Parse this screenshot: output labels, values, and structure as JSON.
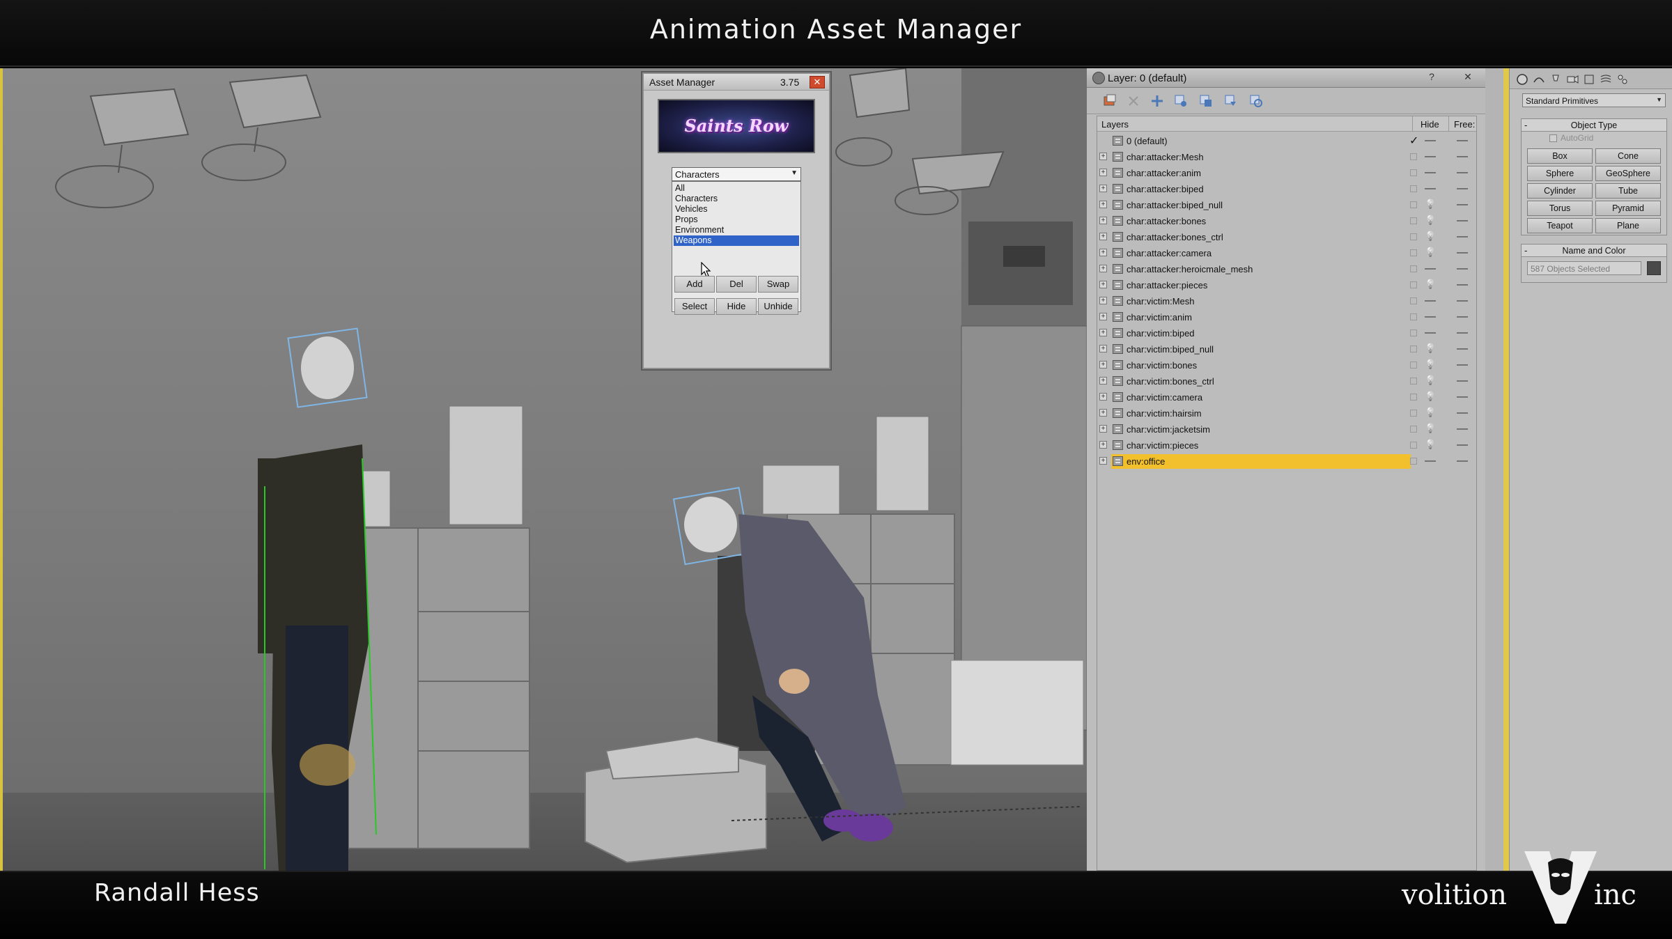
{
  "video": {
    "title": "Animation Asset Manager",
    "presenter": "Randall Hess",
    "brand_left": "volition",
    "brand_right": "inc"
  },
  "asset_manager": {
    "title": "Asset Manager",
    "version": "3.75",
    "logo_text": "Saints Row",
    "category_selected": "Characters",
    "category_options": [
      "All",
      "Characters",
      "Vehicles",
      "Props",
      "Environment",
      "Weapons"
    ],
    "highlighted_option": "Weapons",
    "buttons_row1": [
      "Add",
      "Del",
      "Swap"
    ],
    "buttons_row2": [
      "Select",
      "Hide",
      "Unhide"
    ]
  },
  "layer_manager": {
    "title": "Layer: 0 (default)",
    "columns": {
      "layers": "Layers",
      "hide": "Hide",
      "freeze": "Free:"
    },
    "rows": [
      {
        "name": "0 (default)",
        "current": true,
        "hide": "—",
        "freeze": "—"
      },
      {
        "name": "char:attacker:Mesh",
        "hide": "—",
        "freeze": "—"
      },
      {
        "name": "char:attacker:anim",
        "hide": "—",
        "freeze": "—"
      },
      {
        "name": "char:attacker:biped",
        "hide": "—",
        "freeze": "—"
      },
      {
        "name": "char:attacker:biped_null",
        "hide": "bulb",
        "freeze": "—"
      },
      {
        "name": "char:attacker:bones",
        "hide": "bulb",
        "freeze": "—"
      },
      {
        "name": "char:attacker:bones_ctrl",
        "hide": "bulb",
        "freeze": "—"
      },
      {
        "name": "char:attacker:camera",
        "hide": "bulb",
        "freeze": "—"
      },
      {
        "name": "char:attacker:heroicmale_mesh",
        "hide": "—",
        "freeze": "—"
      },
      {
        "name": "char:attacker:pieces",
        "hide": "bulb",
        "freeze": "—"
      },
      {
        "name": "char:victim:Mesh",
        "hide": "—",
        "freeze": "—"
      },
      {
        "name": "char:victim:anim",
        "hide": "—",
        "freeze": "—"
      },
      {
        "name": "char:victim:biped",
        "hide": "—",
        "freeze": "—"
      },
      {
        "name": "char:victim:biped_null",
        "hide": "bulb",
        "freeze": "—"
      },
      {
        "name": "char:victim:bones",
        "hide": "bulb",
        "freeze": "—"
      },
      {
        "name": "char:victim:bones_ctrl",
        "hide": "bulb",
        "freeze": "—"
      },
      {
        "name": "char:victim:camera",
        "hide": "bulb",
        "freeze": "—"
      },
      {
        "name": "char:victim:hairsim",
        "hide": "bulb",
        "freeze": "—"
      },
      {
        "name": "char:victim:jacketsim",
        "hide": "bulb",
        "freeze": "—"
      },
      {
        "name": "char:victim:pieces",
        "hide": "bulb",
        "freeze": "—"
      },
      {
        "name": "env:office",
        "highlighted": true,
        "hide": "—",
        "freeze": "—"
      }
    ]
  },
  "command_panel": {
    "primitive_type": "Standard Primitives",
    "object_type_header": "Object Type",
    "autogrid_label": "AutoGrid",
    "object_buttons": [
      "Box",
      "Cone",
      "Sphere",
      "GeoSphere",
      "Cylinder",
      "Tube",
      "Torus",
      "Pyramid",
      "Teapot",
      "Plane"
    ],
    "name_color_header": "Name and Color",
    "selection_text": "587 Objects Selected"
  },
  "colors": {
    "highlight": "#f2c02c",
    "list_selection": "#2f63c8",
    "viewport_border": "#d8c341"
  }
}
